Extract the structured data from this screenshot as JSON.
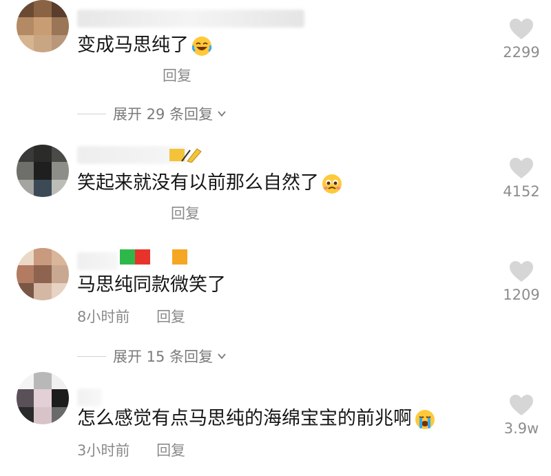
{
  "comments": [
    {
      "content": "变成马思纯了",
      "emoji": "laughing-crying-emoji",
      "time": "",
      "reply_label": "回复",
      "likes": "2299",
      "expand": "展开 29 条回复"
    },
    {
      "content": "笑起来就没有以前那么自然了",
      "emoji": "pleading-face-emoji",
      "time": "",
      "reply_label": "回复",
      "likes": "4152",
      "expand": ""
    },
    {
      "content": "马思纯同款微笑了",
      "emoji": "",
      "time": "8小时前",
      "reply_label": "回复",
      "likes": "1209",
      "expand": "展开 15 条回复"
    },
    {
      "content": "怎么感觉有点马思纯的海绵宝宝的前兆啊",
      "emoji": "loudly-crying-emoji",
      "time": "3小时前",
      "reply_label": "回复",
      "likes": "3.9w",
      "expand": ""
    }
  ],
  "icons": {
    "like": "heart-icon",
    "expand": "chevron-down-icon"
  },
  "colors": {
    "content_text": "#161616",
    "meta_text": "#8a8a8a",
    "like_icon": "#d6d6d6",
    "badge_green": "#2fb84a",
    "badge_red": "#e8332c",
    "badge_orange": "#f5a623"
  }
}
